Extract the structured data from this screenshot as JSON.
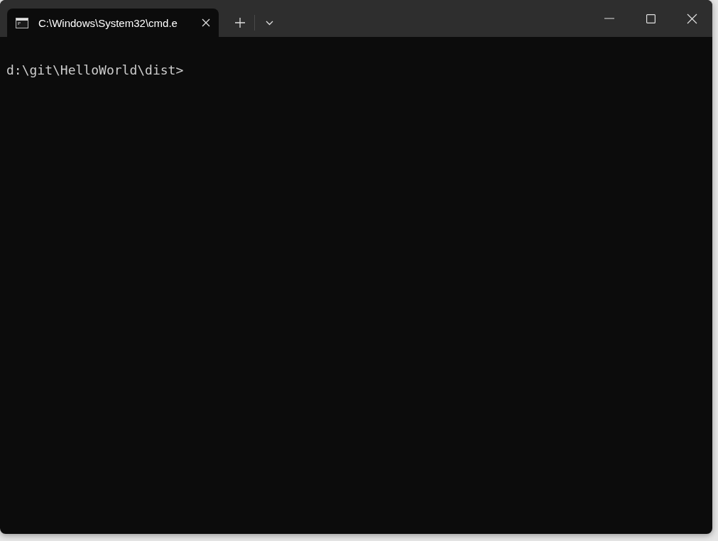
{
  "tabs": [
    {
      "title": "C:\\Windows\\System32\\cmd.e",
      "selected": true
    }
  ],
  "terminal": {
    "lines": [
      "d:\\git\\HelloWorld\\dist>"
    ]
  }
}
